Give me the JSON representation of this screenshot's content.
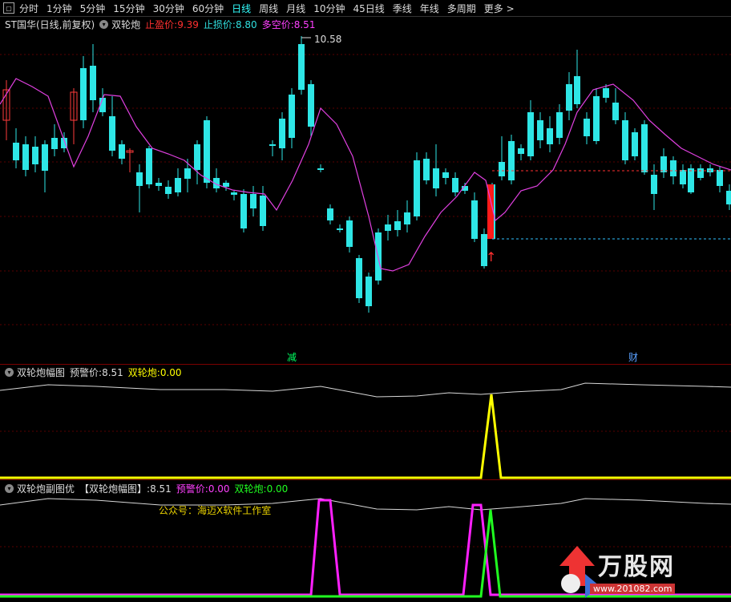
{
  "toolbar": {
    "icon": "window-icon",
    "items": [
      "分时",
      "1分钟",
      "5分钟",
      "15分钟",
      "30分钟",
      "60分钟",
      "日线",
      "周线",
      "月线",
      "10分钟",
      "45日线",
      "季线",
      "年线",
      "多周期",
      "更多 >"
    ],
    "active_index": 6
  },
  "main_header": {
    "title": "ST国华(日线,前复权)",
    "indicator": "双轮炮",
    "stop_profit_label": "止盈价:",
    "stop_profit_value": "9.39",
    "stop_loss_label": "止损价:",
    "stop_loss_value": "8.80",
    "longshort_label": "多空价:",
    "longshort_value": "8.51",
    "high_label": "10.58"
  },
  "badges": {
    "jian": "减",
    "cai": "财"
  },
  "panel2": {
    "title": "双轮炮幅图",
    "warn_label": "预警价:",
    "warn_value": "8.51",
    "sig_label": "双轮炮:",
    "sig_value": "0.00"
  },
  "panel3": {
    "title": "双轮炮副图优",
    "ref_label": "【双轮炮幅图】:",
    "ref_value": "8.51",
    "warn_label": "预警价:",
    "warn_value": "0.00",
    "sig_label": "双轮炮:",
    "sig_value": "0.00",
    "note": "公众号：海迈X软件工作室"
  },
  "watermark": {
    "brand": "万股网",
    "url": "www.201082.com"
  },
  "colors": {
    "up": "#ff3b3b",
    "down": "#2ee6e6",
    "ma": "#e040e0",
    "stop_profit": "#ff3030",
    "stop_loss": "#30c0ff",
    "yellow": "#ffff00",
    "magenta": "#ff20ff",
    "green": "#20ff20",
    "white_line": "#d8d8d8"
  }
}
